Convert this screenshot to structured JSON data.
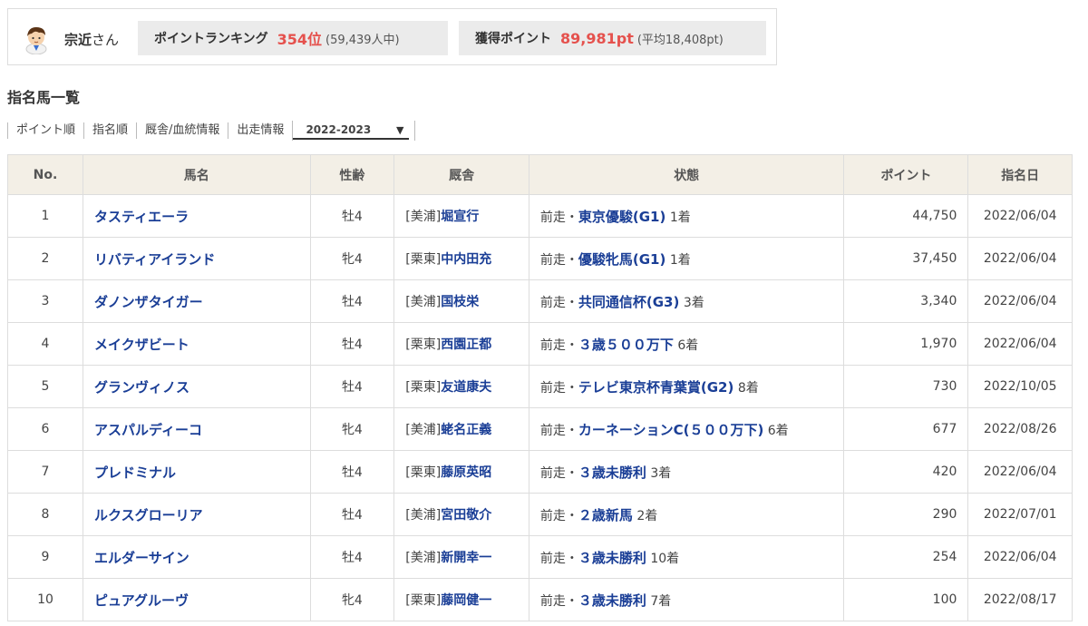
{
  "profile": {
    "user_name": "宗近",
    "honorific": "さん",
    "ranking": {
      "label": "ポイントランキング",
      "value": "354位",
      "sub": "(59,439人中)"
    },
    "points": {
      "label": "獲得ポイント",
      "value": "89,981pt",
      "sub": "(平均18,408pt)"
    }
  },
  "section_title": "指名馬一覧",
  "sort_bar": {
    "items": [
      "ポイント順",
      "指名順",
      "厩舎/血統情報",
      "出走情報"
    ],
    "season": "2022-2023",
    "season_arrow": "▼"
  },
  "table": {
    "headers": [
      "No.",
      "馬名",
      "性齢",
      "厩舎",
      "状態",
      "ポイント",
      "指名日"
    ],
    "rows": [
      {
        "no": "1",
        "name": "タスティエーラ",
        "age": "牡4",
        "region": "[美浦]",
        "trainer": "堀宣行",
        "prefix": "前走・",
        "race": "東京優駿(G1)",
        "place": "1着",
        "points": "44,750",
        "date": "2022/06/04"
      },
      {
        "no": "2",
        "name": "リバティアイランド",
        "age": "牝4",
        "region": "[栗東]",
        "trainer": "中内田充",
        "prefix": "前走・",
        "race": "優駿牝馬(G1)",
        "place": "1着",
        "points": "37,450",
        "date": "2022/06/04"
      },
      {
        "no": "3",
        "name": "ダノンザタイガー",
        "age": "牡4",
        "region": "[美浦]",
        "trainer": "国枝栄",
        "prefix": "前走・",
        "race": "共同通信杯(G3)",
        "place": "3着",
        "points": "3,340",
        "date": "2022/06/04"
      },
      {
        "no": "4",
        "name": "メイクザビート",
        "age": "牡4",
        "region": "[栗東]",
        "trainer": "西園正都",
        "prefix": "前走・",
        "race": "３歳５００万下",
        "place": "6着",
        "points": "1,970",
        "date": "2022/06/04"
      },
      {
        "no": "5",
        "name": "グランヴィノス",
        "age": "牡4",
        "region": "[栗東]",
        "trainer": "友道康夫",
        "prefix": "前走・",
        "race": "テレビ東京杯青葉賞(G2)",
        "place": "8着",
        "points": "730",
        "date": "2022/10/05"
      },
      {
        "no": "6",
        "name": "アスパルディーコ",
        "age": "牝4",
        "region": "[美浦]",
        "trainer": "蛯名正義",
        "prefix": "前走・",
        "race": "カーネーションC(５００万下)",
        "place": "6着",
        "points": "677",
        "date": "2022/08/26"
      },
      {
        "no": "7",
        "name": "プレドミナル",
        "age": "牡4",
        "region": "[栗東]",
        "trainer": "藤原英昭",
        "prefix": "前走・",
        "race": "３歳未勝利",
        "place": "3着",
        "points": "420",
        "date": "2022/06/04"
      },
      {
        "no": "8",
        "name": "ルクスグローリア",
        "age": "牡4",
        "region": "[美浦]",
        "trainer": "宮田敬介",
        "prefix": "前走・",
        "race": "２歳新馬",
        "place": "2着",
        "points": "290",
        "date": "2022/07/01"
      },
      {
        "no": "9",
        "name": "エルダーサイン",
        "age": "牡4",
        "region": "[美浦]",
        "trainer": "新開幸一",
        "prefix": "前走・",
        "race": "３歳未勝利",
        "place": "10着",
        "points": "254",
        "date": "2022/06/04"
      },
      {
        "no": "10",
        "name": "ピュアグルーヴ",
        "age": "牝4",
        "region": "[栗東]",
        "trainer": "藤岡健一",
        "prefix": "前走・",
        "race": "３歳未勝利",
        "place": "7着",
        "points": "100",
        "date": "2022/08/17"
      }
    ]
  },
  "colors": {
    "accent_red": "#e5514d",
    "link_blue": "#1a3e96",
    "header_bg": "#f3efe6",
    "stat_bg": "#ebebeb"
  },
  "icons": {
    "avatar": "user-avatar-icon"
  }
}
